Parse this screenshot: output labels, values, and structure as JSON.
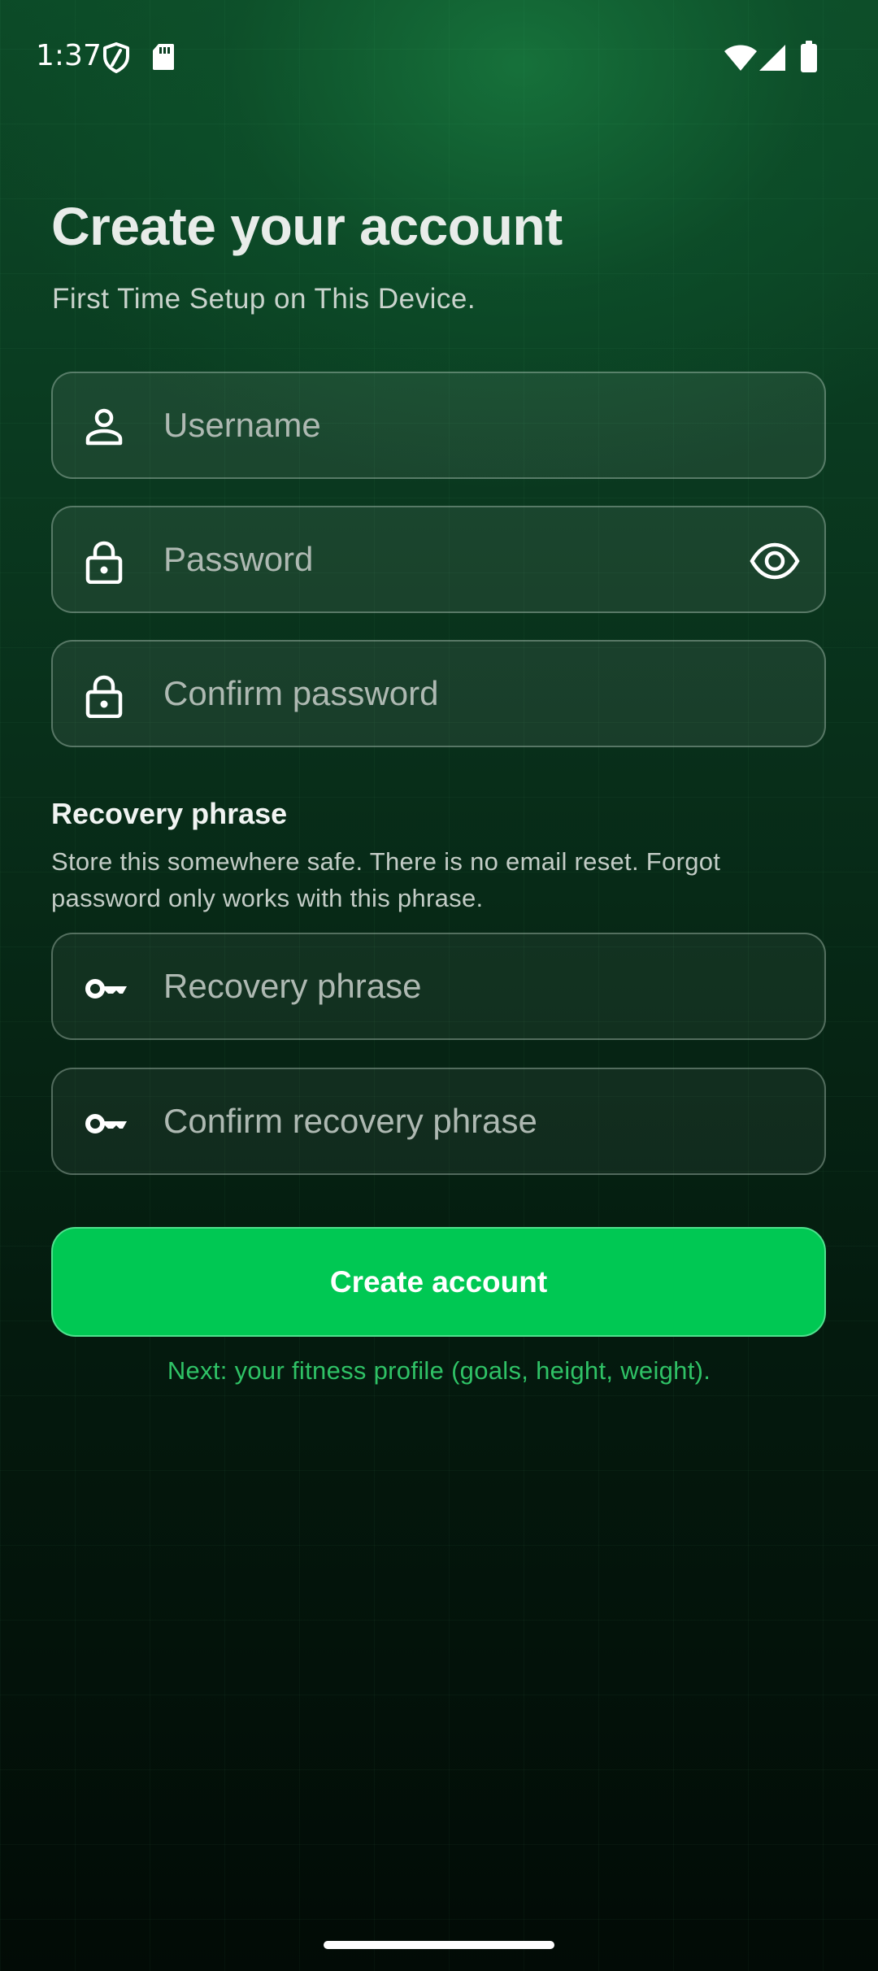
{
  "status_bar": {
    "time": "1:37",
    "icons": [
      "shield-icon",
      "sd-card-icon",
      "wifi-icon",
      "signal-icon",
      "battery-icon"
    ]
  },
  "header": {
    "title": "Create your account",
    "subtitle": "First Time Setup on This Device."
  },
  "form": {
    "username": {
      "placeholder": "Username",
      "value": "",
      "icon": "person-icon"
    },
    "password": {
      "placeholder": "Password",
      "value": "",
      "icon": "lock-icon",
      "toggle_icon": "eye-icon"
    },
    "confirm_password": {
      "placeholder": "Confirm password",
      "value": "",
      "icon": "lock-icon"
    }
  },
  "recovery": {
    "title": "Recovery phrase",
    "note": "Store this somewhere safe. There is no email reset. Forgot password only works with this phrase.",
    "phrase": {
      "placeholder": "Recovery phrase",
      "value": "",
      "icon": "key-icon"
    },
    "confirm_phrase": {
      "placeholder": "Confirm recovery phrase",
      "value": "",
      "icon": "key-icon"
    }
  },
  "actions": {
    "create_label": "Create account",
    "next_hint": "Next: your fitness profile (goals, height, weight)."
  },
  "colors": {
    "accent": "#00c853",
    "hint_text": "#2fc266",
    "background_top": "#0c4a27",
    "background_bottom": "#020b06"
  }
}
